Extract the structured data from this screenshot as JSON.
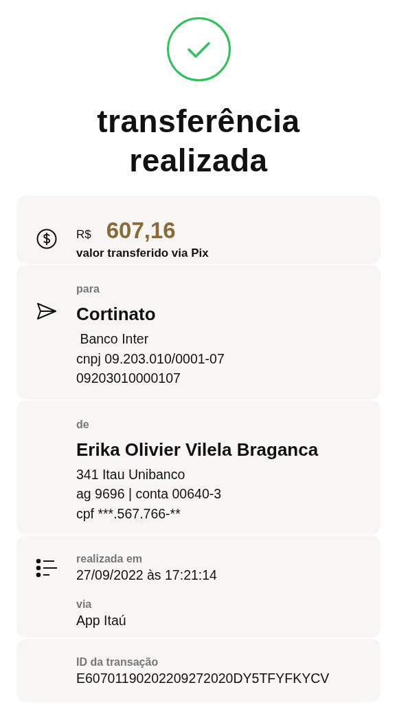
{
  "title": "transferência realizada",
  "amount": {
    "currency": "R$",
    "value": "607,16",
    "caption": "valor transferido via Pix"
  },
  "sections": [
    {
      "kind": "recipient",
      "label": "para",
      "name": "Cortinato",
      "lines": [
        " Banco Inter",
        "cnpj 09.203.010/0001-07",
        "09203010000107"
      ]
    },
    {
      "kind": "sender",
      "label": "de",
      "name": "Erika Olivier Vilela Braganca",
      "lines": [
        "341 Itau Unibanco",
        "ag 9696 | conta 00640-3",
        "cpf ***.567.766-**"
      ]
    },
    {
      "kind": "timing",
      "fields": [
        {
          "label": "realizada em",
          "value": "27/09/2022 às 17:21:14"
        },
        {
          "label": "via",
          "value": "App Itaú"
        }
      ]
    },
    {
      "kind": "transaction",
      "fields": [
        {
          "label": "ID da transação",
          "value": "E60701190202209272020DY5TFYFKYCV"
        }
      ]
    }
  ]
}
